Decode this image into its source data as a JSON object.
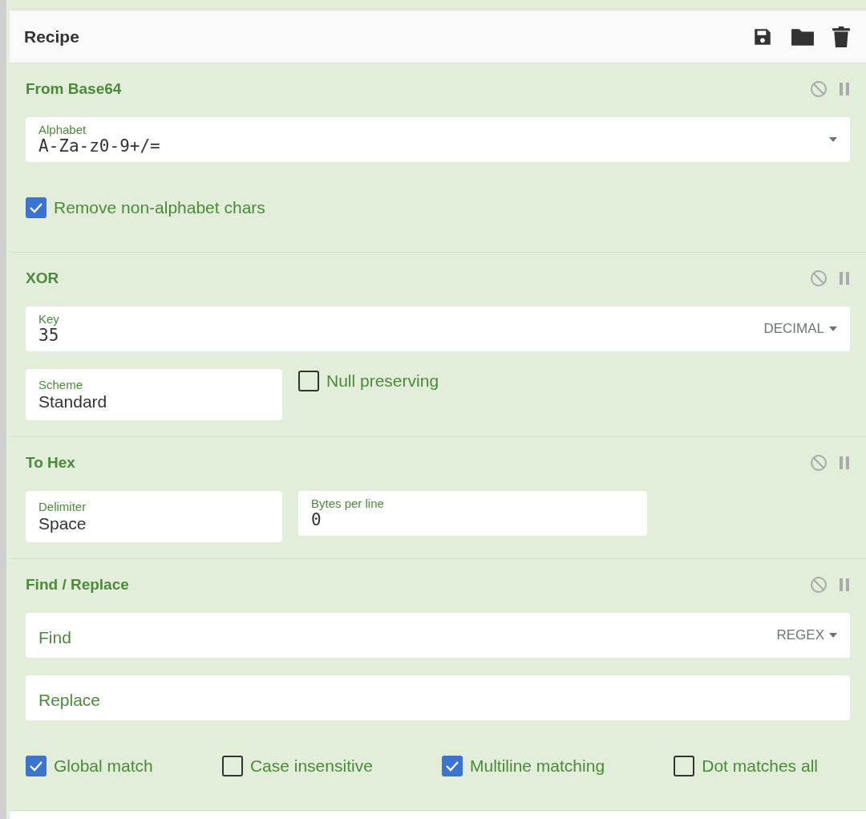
{
  "recipe": {
    "title": "Recipe"
  },
  "operations": [
    {
      "name": "From Base64",
      "disabled": false,
      "paused": false,
      "rows": [
        [
          {
            "kind": "code_field",
            "label": "Alphabet",
            "value": "A-Za-z0-9+/=",
            "dropdown": true
          }
        ],
        [
          {
            "kind": "checkbox",
            "label": "Remove non-alphabet chars",
            "checked": true
          }
        ]
      ]
    },
    {
      "name": "XOR",
      "disabled": false,
      "paused": false,
      "rows": [
        [
          {
            "kind": "code_field",
            "label": "Key",
            "value": "35",
            "toggle": "DECIMAL"
          }
        ],
        [
          {
            "kind": "short_field",
            "label": "Scheme",
            "value": "Standard"
          },
          {
            "kind": "checkbox",
            "label": "Null preserving",
            "checked": false
          }
        ]
      ]
    },
    {
      "name": "To Hex",
      "disabled": false,
      "paused": false,
      "rows": [
        [
          {
            "kind": "short_field",
            "label": "Delimiter",
            "value": "Space"
          },
          {
            "kind": "short_code_field",
            "label": "Bytes per line",
            "value": "0"
          }
        ]
      ]
    },
    {
      "name": "Find / Replace",
      "disabled": false,
      "paused": false,
      "rows": [
        [
          {
            "kind": "text_field",
            "placeholder": "Find",
            "toggle": "REGEX"
          }
        ],
        [
          {
            "kind": "text_field",
            "placeholder": "Replace"
          }
        ],
        [
          {
            "kind": "checkbox",
            "label": "Global match",
            "checked": true
          },
          {
            "kind": "checkbox",
            "label": "Case insensitive",
            "checked": false
          },
          {
            "kind": "checkbox",
            "label": "Multiline matching",
            "checked": true
          },
          {
            "kind": "checkbox",
            "label": "Dot matches all",
            "checked": false
          }
        ]
      ]
    }
  ]
}
